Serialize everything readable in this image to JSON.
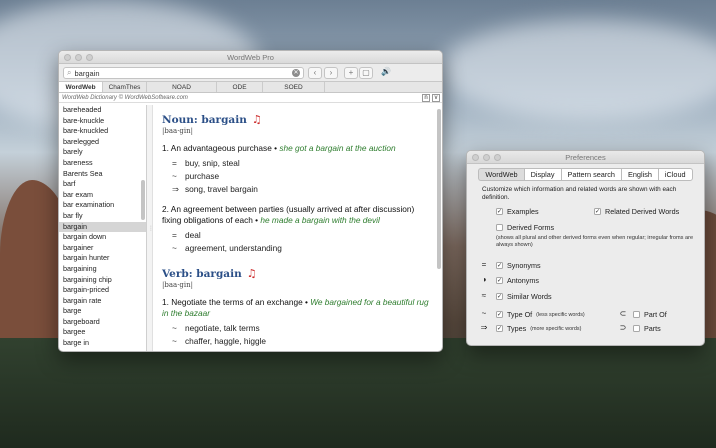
{
  "wordweb": {
    "window_title": "WordWeb Pro",
    "search_value": "bargain",
    "tabs": [
      "WordWeb",
      "ChamThes",
      "NOAD",
      "ODE",
      "SOED"
    ],
    "info_text": "WordWeb Dictionary © WordWebSoftware.com",
    "info_btn_n": "n",
    "info_btn_v": "v",
    "word_list": [
      "bareheaded",
      "bare-knuckle",
      "bare-knuckled",
      "barelegged",
      "barely",
      "bareness",
      "Barents Sea",
      "barf",
      "bar exam",
      "bar examination",
      "bar fly",
      "bargain",
      "bargain down",
      "bargainer",
      "bargain hunter",
      "bargaining",
      "bargaining chip",
      "bargain-priced",
      "bargain rate",
      "barge",
      "bargeboard",
      "bargee",
      "barge in"
    ],
    "selected_word": "bargain",
    "noun_head": "Noun: bargain",
    "noun_pron": "|baa·gin|",
    "noun_senses": [
      {
        "num": "1.",
        "text": "An advantageous purchase",
        "example": "she got a bargain at the auction",
        "rels": [
          {
            "sym": "=",
            "text": "buy, snip, steal"
          },
          {
            "sym": "~",
            "text": "purchase"
          },
          {
            "sym": "⇒",
            "text": "song, travel bargain"
          }
        ]
      },
      {
        "num": "2.",
        "text": "An agreement between parties (usually arrived at after discussion) fixing obligations of each",
        "example": "he made a bargain with the devil",
        "rels": [
          {
            "sym": "=",
            "text": "deal"
          },
          {
            "sym": "~",
            "text": "agreement, understanding"
          }
        ]
      }
    ],
    "verb_head": "Verb: bargain",
    "verb_pron": "|baa·gin|",
    "verb_senses": [
      {
        "num": "1.",
        "text": "Negotiate the terms of an exchange",
        "example": "We bargained for a beautiful rug in the bazaar",
        "rels": [
          {
            "sym": "~",
            "text": "negotiate, talk terms"
          },
          {
            "sym": "~",
            "text": "chaffer, haggle, higgle"
          }
        ]
      }
    ]
  },
  "preferences": {
    "window_title": "Preferences",
    "tabs": [
      "WordWeb",
      "Display",
      "Pattern search",
      "English",
      "iCloud"
    ],
    "active_tab": "WordWeb",
    "description": "Customize which information and related words are shown with each definition.",
    "examples_label": "Examples",
    "related_derived_label": "Related Derived Words",
    "derived_forms_label": "Derived Forms",
    "derived_note": "(shows all plural and other derived forms even when regular; irregular froms are always shown)",
    "synonyms_label": "Synonyms",
    "antonyms_label": "Antonyms",
    "similar_label": "Similar Words",
    "type_of_label": "Type Of",
    "type_of_note": "(less specific words)",
    "types_label": "Types",
    "types_note": "(more specific words)",
    "part_of_label": "Part Of",
    "parts_label": "Parts"
  }
}
